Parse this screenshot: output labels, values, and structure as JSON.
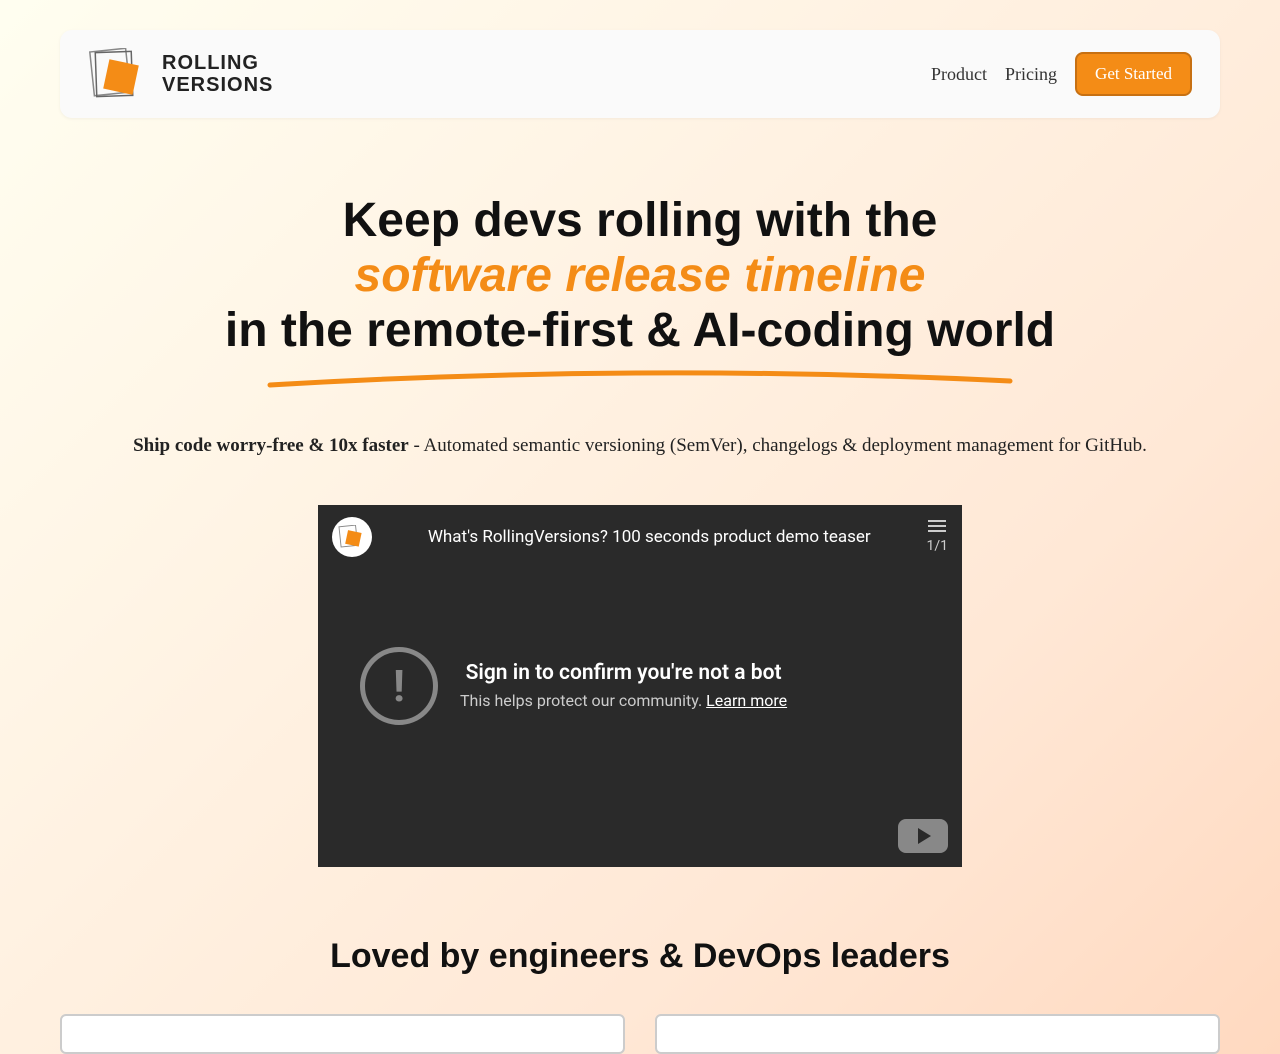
{
  "nav": {
    "brand_line1": "ROLLING",
    "brand_line2": "VERSIONS",
    "product": "Product",
    "pricing": "Pricing",
    "cta": "Get Started"
  },
  "hero": {
    "line1": "Keep devs rolling with the",
    "line2": "software release timeline",
    "line3": "in the remote-first & AI-coding world",
    "sub_bold": "Ship code worry-free & 10x faster",
    "sub_rest": " - Automated semantic versioning (SemVer), changelogs & deployment management for GitHub."
  },
  "video": {
    "title": "What's RollingVersions? 100 seconds product demo teaser",
    "playlist": "1/1",
    "warn_title": "Sign in to confirm you're not a bot",
    "warn_sub": "This helps protect our community. ",
    "learn_more": "Learn more"
  },
  "testimonials": {
    "heading": "Loved by engineers & DevOps leaders"
  }
}
